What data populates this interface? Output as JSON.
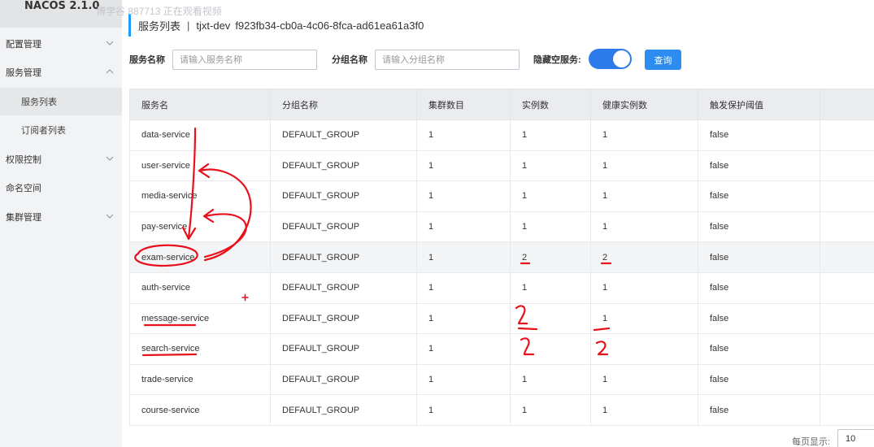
{
  "app": {
    "brand": "NACOS 2.1.0",
    "watermark": "博学谷 887713 正在观看视频"
  },
  "sidebar": {
    "items": [
      {
        "label": "配置管理"
      },
      {
        "label": "服务管理"
      },
      {
        "label": "服务列表"
      },
      {
        "label": "订阅者列表"
      },
      {
        "label": "权限控制"
      },
      {
        "label": "命名空间"
      },
      {
        "label": "集群管理"
      }
    ]
  },
  "header": {
    "title": "服务列表",
    "separator": "|",
    "namespace": "tjxt-dev",
    "namespace_id": "f923fb34-cb0a-4c06-8fca-ad61ea61a3f0"
  },
  "filters": {
    "service_name_label": "服务名称",
    "service_name_placeholder": "请输入服务名称",
    "group_name_label": "分组名称",
    "group_name_placeholder": "请输入分组名称",
    "hide_empty_label": "隐藏空服务:",
    "hide_empty_on": true,
    "query_label": "查询"
  },
  "table": {
    "columns": [
      "服务名",
      "分组名称",
      "集群数目",
      "实例数",
      "健康实例数",
      "触发保护阈值"
    ],
    "rows": [
      [
        "data-service",
        "DEFAULT_GROUP",
        "1",
        "1",
        "1",
        "false"
      ],
      [
        "user-service",
        "DEFAULT_GROUP",
        "1",
        "1",
        "1",
        "false"
      ],
      [
        "media-service",
        "DEFAULT_GROUP",
        "1",
        "1",
        "1",
        "false"
      ],
      [
        "pay-service",
        "DEFAULT_GROUP",
        "1",
        "1",
        "1",
        "false"
      ],
      [
        "exam-service",
        "DEFAULT_GROUP",
        "1",
        "2",
        "2",
        "false"
      ],
      [
        "auth-service",
        "DEFAULT_GROUP",
        "1",
        "1",
        "1",
        "false"
      ],
      [
        "message-service",
        "DEFAULT_GROUP",
        "1",
        "",
        "1",
        "false"
      ],
      [
        "search-service",
        "DEFAULT_GROUP",
        "1",
        "",
        "",
        "false"
      ],
      [
        "trade-service",
        "DEFAULT_GROUP",
        "1",
        "1",
        "1",
        "false"
      ],
      [
        "course-service",
        "DEFAULT_GROUP",
        "1",
        "1",
        "1",
        "false"
      ]
    ]
  },
  "pagination": {
    "per_page_label": "每页显示:",
    "per_page_value": "10"
  },
  "colors": {
    "accent": "#209bfa",
    "toggle": "#2d7bea",
    "button": "#2d8cf0",
    "annotation": "#e8111b"
  }
}
